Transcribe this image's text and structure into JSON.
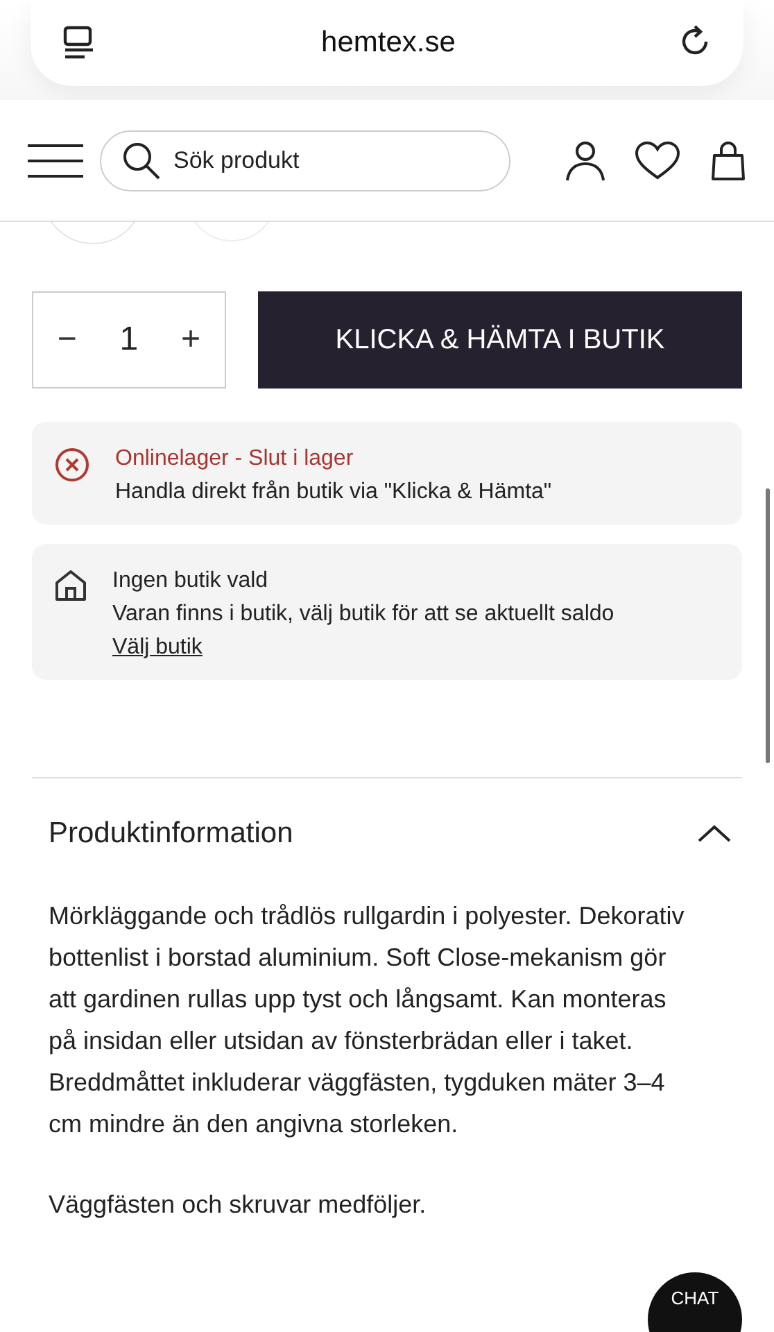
{
  "browser": {
    "address": "hemtex.se"
  },
  "header": {
    "search_placeholder": "Sök produkt"
  },
  "quantity": {
    "decrease": "−",
    "value": "1",
    "increase": "+"
  },
  "add_button": "KLICKA & HÄMTA I BUTIK",
  "notices": [
    {
      "kind": "error",
      "title": "Onlinelager - Slut i lager",
      "text": "Handla direkt från butik via \"Klicka & Hämta\""
    },
    {
      "kind": "store",
      "title": "Ingen butik vald",
      "text": "Varan finns i butik, välj butik för att se aktuellt saldo",
      "link": "Välj butik"
    }
  ],
  "accordion": {
    "title": "Produktinformation",
    "expanded": true,
    "paragraphs": [
      "Mörkläggande och trådlös rullgardin i polyester. Dekorativ bottenlist i borstad aluminium. Soft Close-mekanism gör att gardinen rullas upp tyst och långsamt. Kan monteras på insidan eller utsidan av fönsterbrädan eller i taket. Breddmåttet inkluderar väggfästen, tygduken mäter 3–4 cm mindre än den angivna storleken.",
      "Väggfästen och skruvar medföljer."
    ]
  },
  "chat": "CHAT"
}
